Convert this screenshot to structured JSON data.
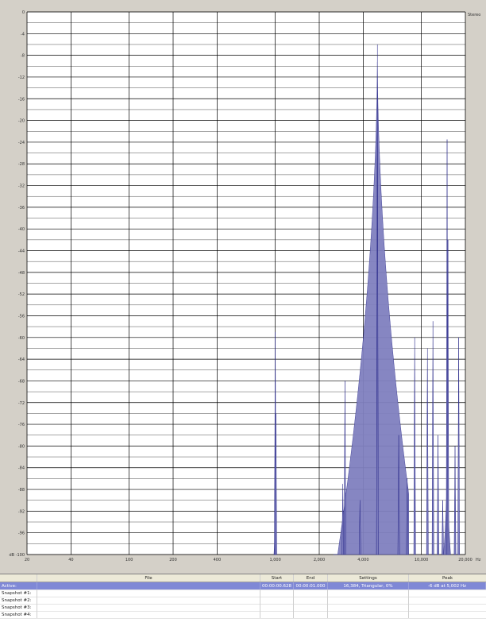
{
  "stereo_label": "Stereo",
  "colors": {
    "background": "#d4d0c8",
    "plot_bg": "#ffffff",
    "grid": "#000000",
    "spectrum_fill": "#7f7fbf",
    "spectrum_line": "#2a2a8a",
    "active_row": "#7f88d6"
  },
  "chart_data": {
    "type": "area",
    "title": "",
    "xlabel": "Hz",
    "ylabel": "dB",
    "xscale": "log",
    "xlim": [
      20,
      20000
    ],
    "ylim": [
      -100,
      0
    ],
    "y_ticks": [
      "0",
      "-4",
      "-8",
      "-12",
      "-16",
      "-20",
      "-24",
      "-28",
      "-32",
      "-36",
      "-40",
      "-44",
      "-48",
      "-52",
      "-56",
      "-60",
      "-64",
      "-68",
      "-72",
      "-76",
      "-80",
      "-84",
      "-88",
      "-92",
      "-96",
      "dB -100"
    ],
    "x_ticks": [
      "20",
      "40",
      "100",
      "200",
      "400",
      "1,000",
      "2,000",
      "4,000",
      "10,000",
      "20,000"
    ],
    "x_unit": "Hz",
    "grid": true,
    "peaks": [
      {
        "freq": 1000,
        "db": -59
      },
      {
        "freq": 1010,
        "db": -74
      },
      {
        "freq": 2900,
        "db": -87
      },
      {
        "freq": 3000,
        "db": -68
      },
      {
        "freq": 3800,
        "db": -90
      },
      {
        "freq": 5000,
        "db": -6
      },
      {
        "freq": 5000,
        "db": -24
      },
      {
        "freq": 7000,
        "db": -78
      },
      {
        "freq": 8000,
        "db": -86
      },
      {
        "freq": 9000,
        "db": -60
      },
      {
        "freq": 11000,
        "db": -62
      },
      {
        "freq": 12000,
        "db": -57
      },
      {
        "freq": 13000,
        "db": -78
      },
      {
        "freq": 14000,
        "db": -90
      },
      {
        "freq": 15000,
        "db": -23.5
      },
      {
        "freq": 15200,
        "db": -42
      },
      {
        "freq": 17000,
        "db": -80
      },
      {
        "freq": 18000,
        "db": -60
      }
    ]
  },
  "table": {
    "headers": [
      "",
      "File",
      "Start",
      "End",
      "Settings",
      "Peak"
    ],
    "rows": [
      {
        "label": "Active:",
        "file": "",
        "start": "00:00:00.628",
        "end": "00:00:01.000",
        "settings": "16,384, Triangular, 0%",
        "peak": "-6 dB at 5,002 Hz"
      },
      {
        "label": "Snapshot #1:",
        "file": "",
        "start": "",
        "end": "",
        "settings": "",
        "peak": ""
      },
      {
        "label": "Snapshot #2:",
        "file": "",
        "start": "",
        "end": "",
        "settings": "",
        "peak": ""
      },
      {
        "label": "Snapshot #3:",
        "file": "",
        "start": "",
        "end": "",
        "settings": "",
        "peak": ""
      },
      {
        "label": "Snapshot #4:",
        "file": "",
        "start": "",
        "end": "",
        "settings": "",
        "peak": ""
      }
    ]
  }
}
